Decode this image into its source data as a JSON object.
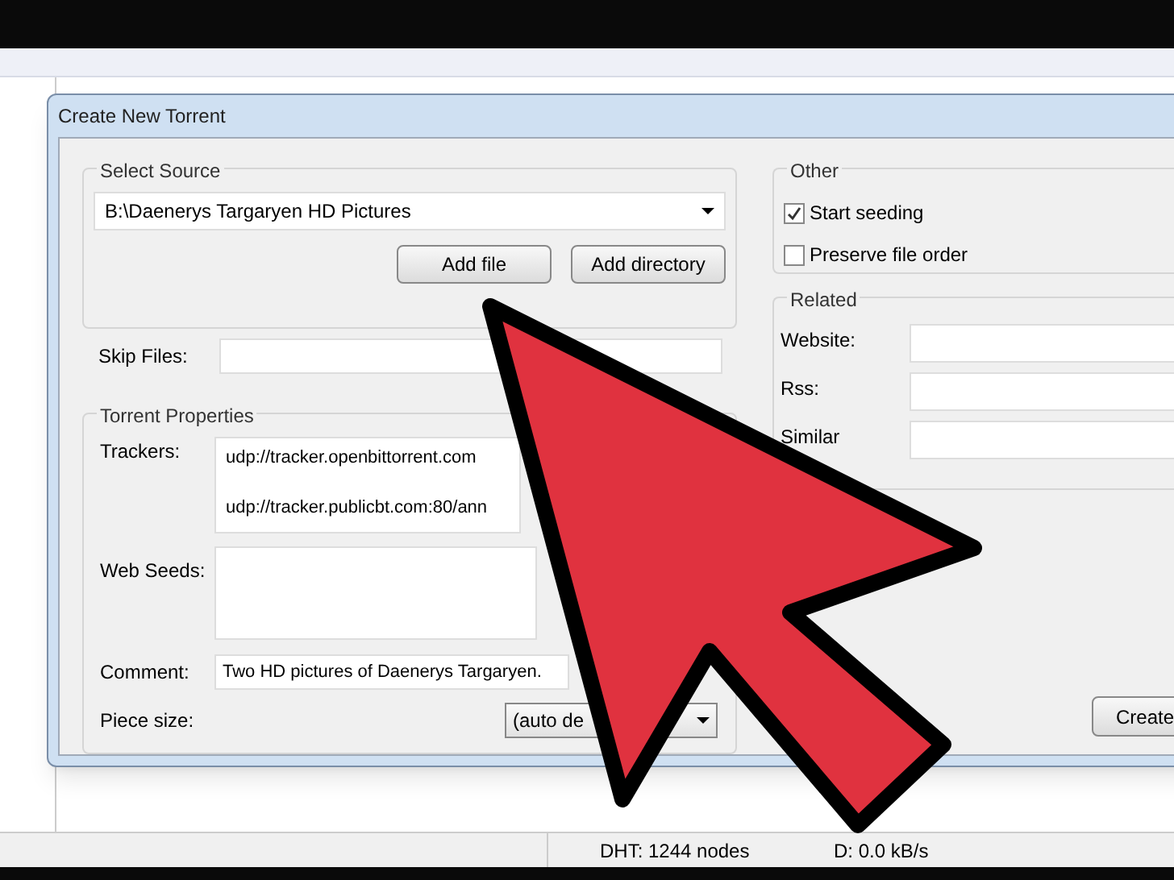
{
  "dialog": {
    "title": "Create New Torrent",
    "select_source": {
      "heading": "Select Source",
      "path": "B:\\Daenerys Targaryen HD Pictures",
      "buttons": [
        "Add file",
        "Add directory"
      ]
    },
    "skip_files": {
      "label": "Skip Files:"
    },
    "torrent_properties": {
      "heading": "Torrent Properties",
      "trackers_label": "Trackers:",
      "trackers": [
        "udp://tracker.openbittorrent.com",
        "udp://tracker.publicbt.com:80/ann"
      ],
      "web_seeds_label": "Web Seeds:",
      "comment_label": "Comment:",
      "comment": "Two HD pictures of Daenerys Targaryen.",
      "piece_size_label": "Piece size:",
      "piece_size": "(auto de"
    },
    "other": {
      "heading": "Other",
      "options": [
        {
          "label": "Start seeding",
          "checked": true
        },
        {
          "label": "Preserve file order",
          "checked": false
        }
      ]
    },
    "related": {
      "heading": "Related",
      "fields": [
        {
          "label": "Website:"
        },
        {
          "label": "Rss:"
        },
        {
          "label": "Similar"
        }
      ]
    },
    "create_button": "Create"
  },
  "status_bar": [
    "DHT: 1244 nodes",
    "D: 0.0 kB/s"
  ]
}
